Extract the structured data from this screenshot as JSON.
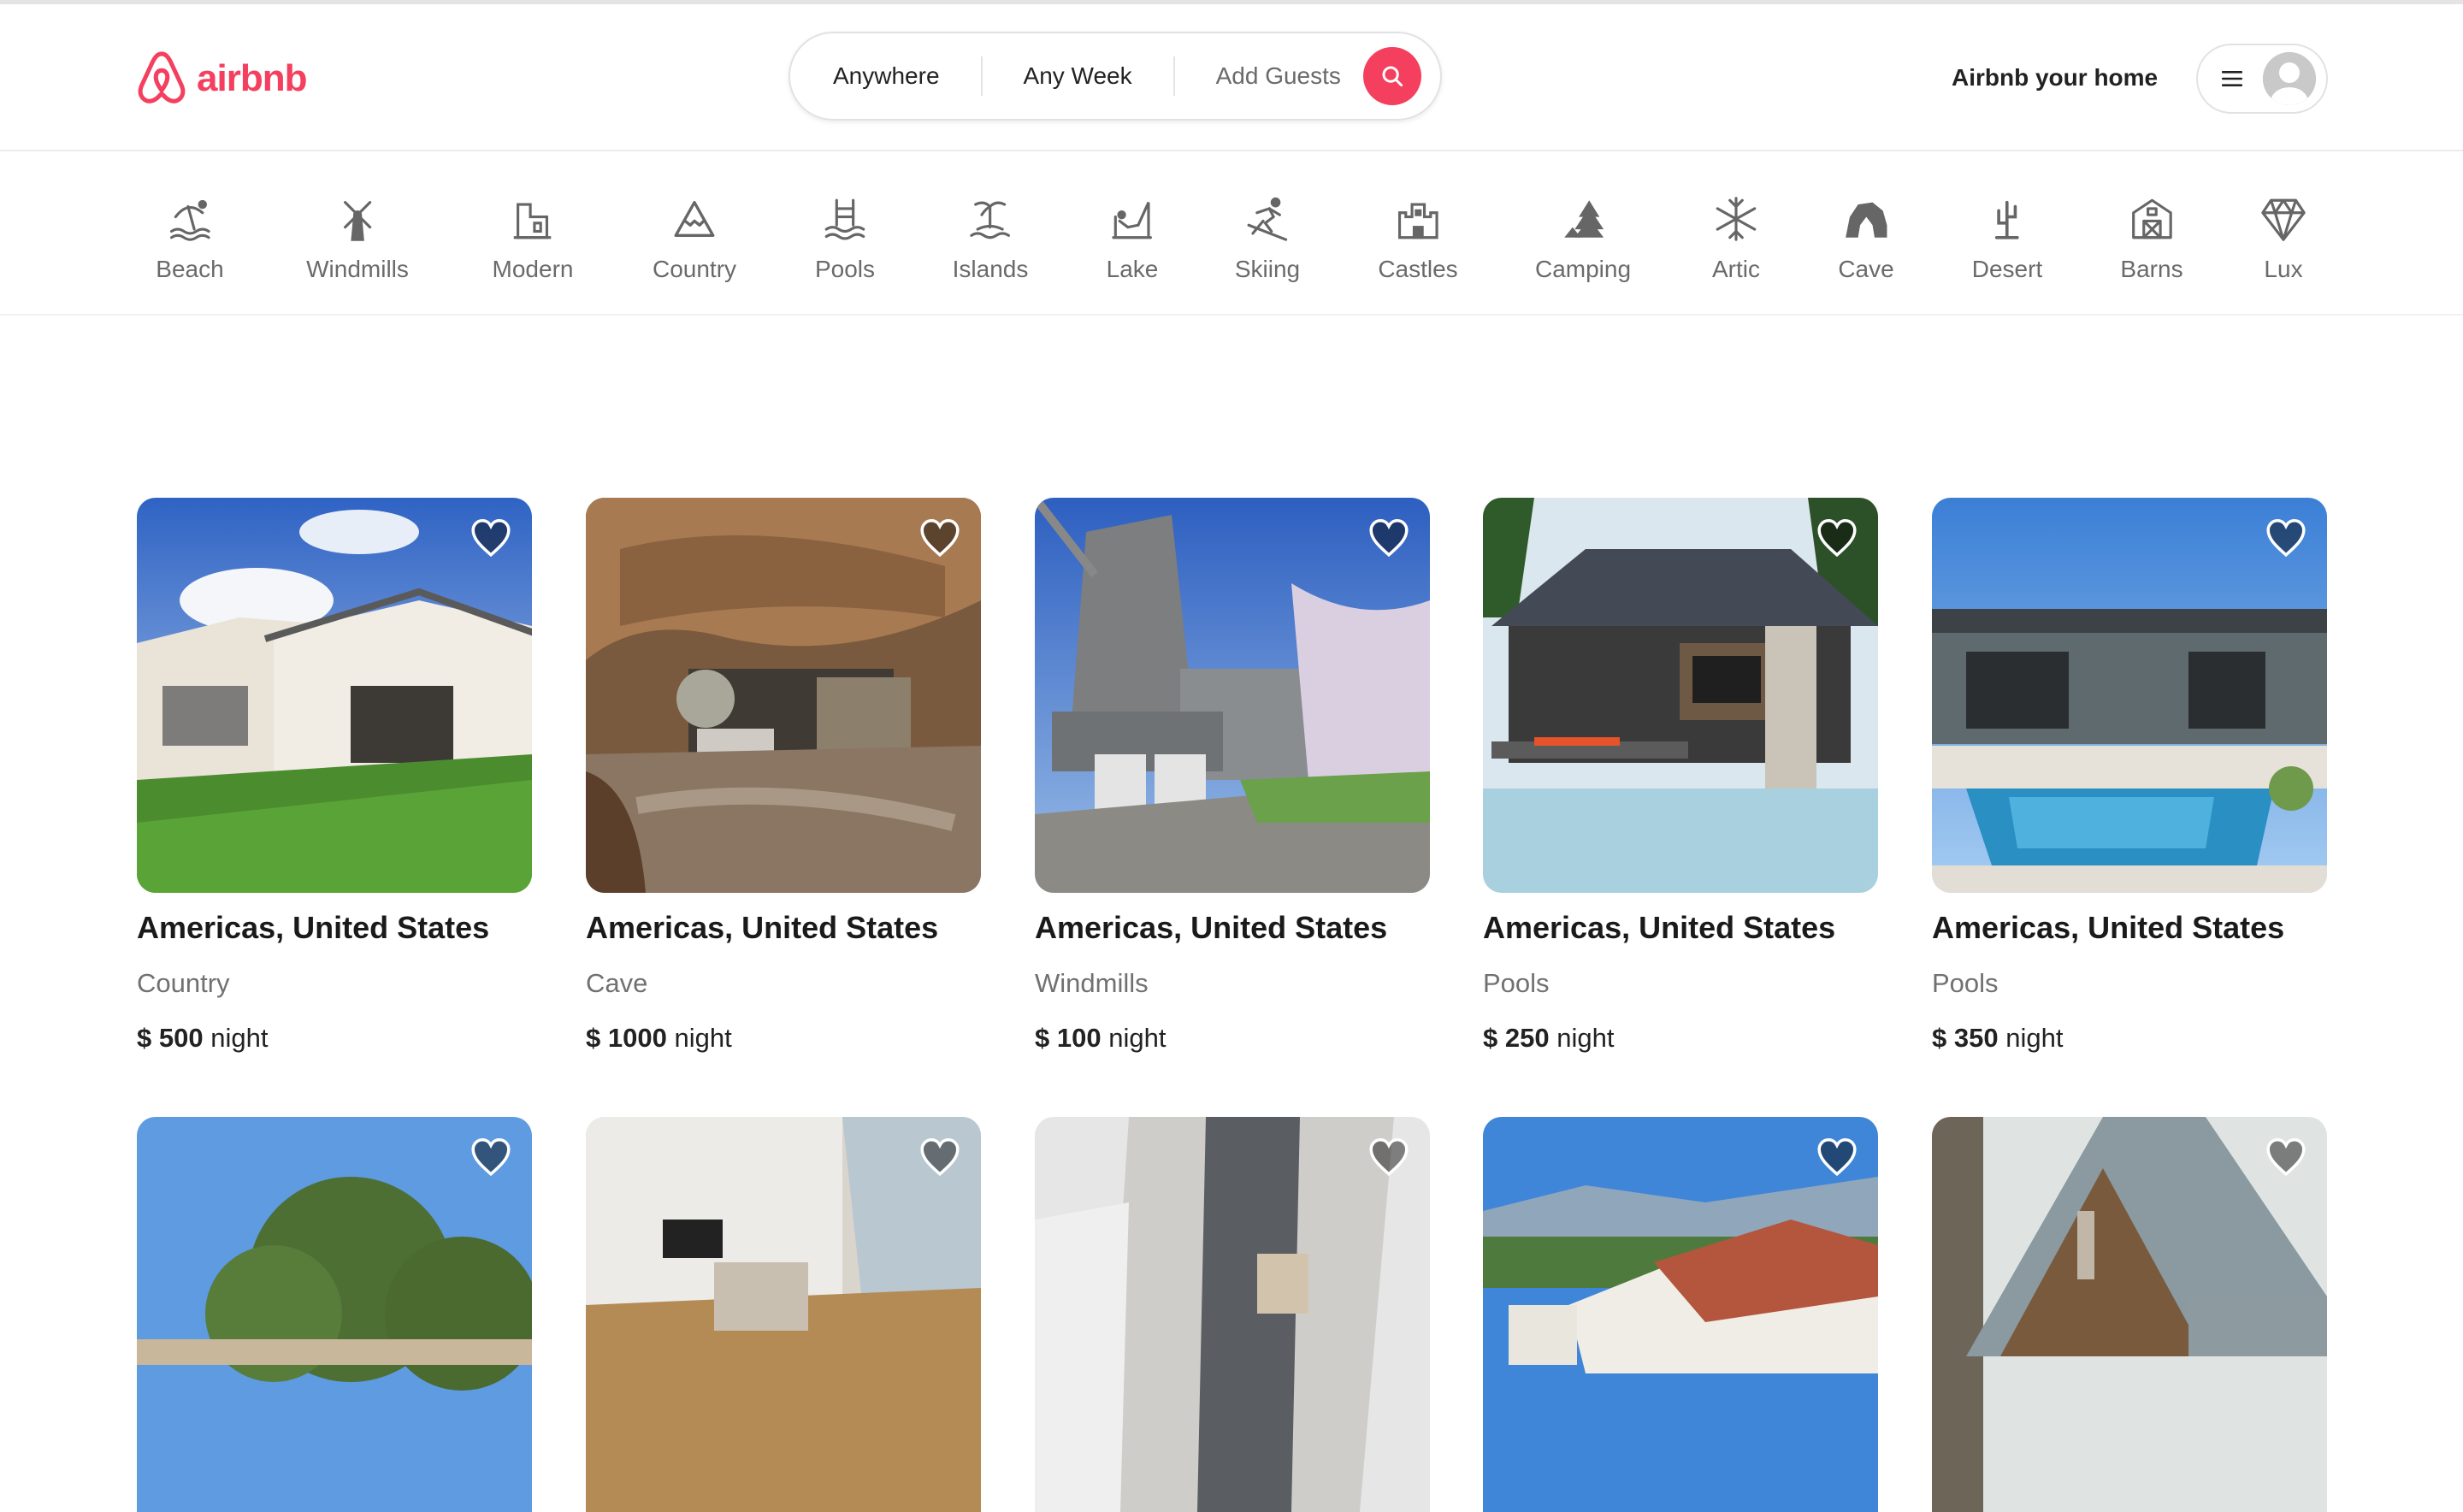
{
  "brand": {
    "name": "airbnb",
    "color": "#f43f5e"
  },
  "search": {
    "where": "Anywhere",
    "when": "Any Week",
    "guests": "Add Guests",
    "button_icon": "search-icon"
  },
  "host": {
    "label": "Airbnb your home"
  },
  "user_menu": {
    "menu_icon": "hamburger-icon",
    "avatar": "avatar-placeholder"
  },
  "categories": [
    {
      "label": "Beach",
      "icon": "beach-icon"
    },
    {
      "label": "Windmills",
      "icon": "windmill-icon"
    },
    {
      "label": "Modern",
      "icon": "modern-building-icon"
    },
    {
      "label": "Country",
      "icon": "mountain-icon"
    },
    {
      "label": "Pools",
      "icon": "pool-icon"
    },
    {
      "label": "Islands",
      "icon": "island-icon"
    },
    {
      "label": "Lake",
      "icon": "lake-icon"
    },
    {
      "label": "Skiing",
      "icon": "skiing-icon"
    },
    {
      "label": "Castles",
      "icon": "castle-icon"
    },
    {
      "label": "Camping",
      "icon": "camping-icon"
    },
    {
      "label": "Artic",
      "icon": "snowflake-icon"
    },
    {
      "label": "Cave",
      "icon": "cave-icon"
    },
    {
      "label": "Desert",
      "icon": "cactus-icon"
    },
    {
      "label": "Barns",
      "icon": "barn-icon"
    },
    {
      "label": "Lux",
      "icon": "diamond-icon"
    }
  ],
  "listings": [
    {
      "location": "Americas, United States",
      "category": "Country",
      "price": "$ 500",
      "unit": "night"
    },
    {
      "location": "Americas, United States",
      "category": "Cave",
      "price": "$ 1000",
      "unit": "night"
    },
    {
      "location": "Americas, United States",
      "category": "Windmills",
      "price": "$ 100",
      "unit": "night"
    },
    {
      "location": "Americas, United States",
      "category": "Pools",
      "price": "$ 250",
      "unit": "night"
    },
    {
      "location": "Americas, United States",
      "category": "Pools",
      "price": "$ 350",
      "unit": "night"
    }
  ]
}
